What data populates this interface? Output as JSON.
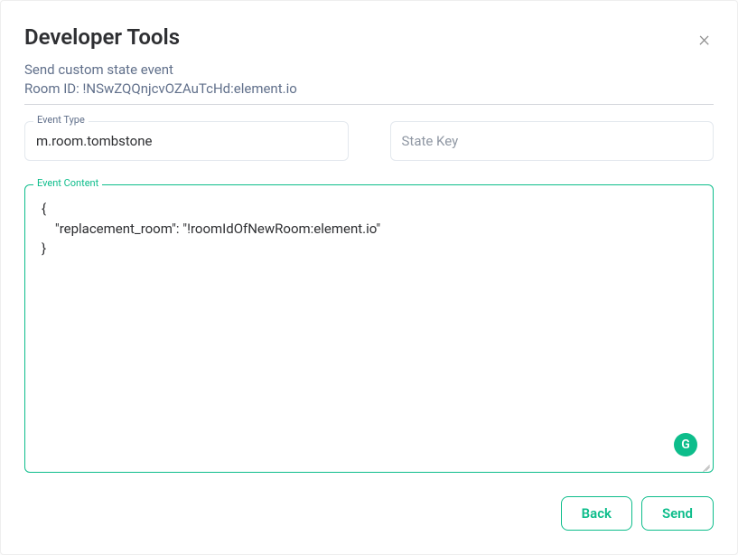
{
  "dialog": {
    "title": "Developer Tools",
    "close_glyph": "×",
    "subtitle_line1": "Send custom state event",
    "subtitle_room_prefix": "Room ID: ",
    "room_id": "!NSwZQQnjcvOZAuTcHd:element.io"
  },
  "fields": {
    "event_type": {
      "label": "Event Type",
      "value": "m.room.tombstone"
    },
    "state_key": {
      "placeholder": "State Key",
      "value": ""
    },
    "event_content": {
      "label": "Event Content",
      "value": "{\n    \"replacement_room\": \"!roomIdOfNewRoom:element.io\"\n}"
    }
  },
  "badge": {
    "glyph": "G"
  },
  "footer": {
    "back": "Back",
    "send": "Send"
  }
}
